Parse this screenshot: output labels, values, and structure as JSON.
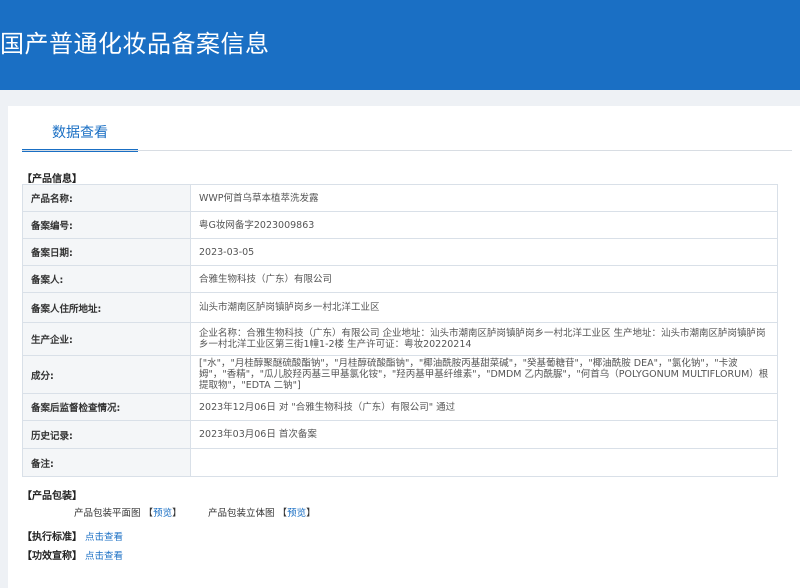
{
  "header": {
    "title": "国产普通化妆品备案信息"
  },
  "tabs": [
    {
      "label": "数据查看"
    }
  ],
  "product_info": {
    "section_label": "【产品信息】",
    "rows": [
      {
        "key": "产品名称:",
        "value": "WWP何首乌草本植萃洗发露"
      },
      {
        "key": "备案编号:",
        "value": "粤G妆网备字2023009863"
      },
      {
        "key": "备案日期:",
        "value": "2023-03-05"
      },
      {
        "key": "备案人:",
        "value": "合雅生物科技（广东）有限公司"
      },
      {
        "key": "备案人住所地址:",
        "value": "汕头市潮南区胪岗镇胪岗乡一村北洋工业区"
      },
      {
        "key": "生产企业:",
        "value": "企业名称：合雅生物科技（广东）有限公司 企业地址：汕头市潮南区胪岗镇胪岗乡一村北洋工业区 生产地址：汕头市潮南区胪岗镇胪岗乡一村北洋工业区第三街1幢1-2楼 生产许可证：粤妆20220214"
      },
      {
        "key": "成分:",
        "value": "[\"水\"，\"月桂醇聚醚硫酸酯钠\"，\"月桂醇硫酸酯钠\"，\"椰油酰胺丙基甜菜碱\"，\"癸基葡糖苷\"，\"椰油酰胺 DEA\"，\"氯化钠\"，\"卡波姆\"，\"香精\"，\"瓜儿胶羟丙基三甲基氯化铵\"，\"羟丙基甲基纤维素\"，\"DMDM 乙内酰脲\"，\"何首乌（POLYGONUM MULTIFLORUM）根提取物\"，\"EDTA 二钠\"]"
      },
      {
        "key": "备案后监督检查情况:",
        "value": "2023年12月06日 对 \"合雅生物科技（广东）有限公司\" 通过"
      },
      {
        "key": "历史记录:",
        "value": "2023年03月06日 首次备案"
      },
      {
        "key": "备注:",
        "value": ""
      }
    ]
  },
  "packaging": {
    "section_label": "【产品包装】",
    "flat_label": "产品包装平面图",
    "flat_link": "预览",
    "solid_label": "产品包装立体图",
    "solid_link": "预览",
    "bracket_open": "【",
    "bracket_close": "】"
  },
  "standard": {
    "section_label": "【执行标准】",
    "link": "点击查看"
  },
  "efficacy": {
    "section_label": "【功效宣称】",
    "link": "点击查看"
  }
}
